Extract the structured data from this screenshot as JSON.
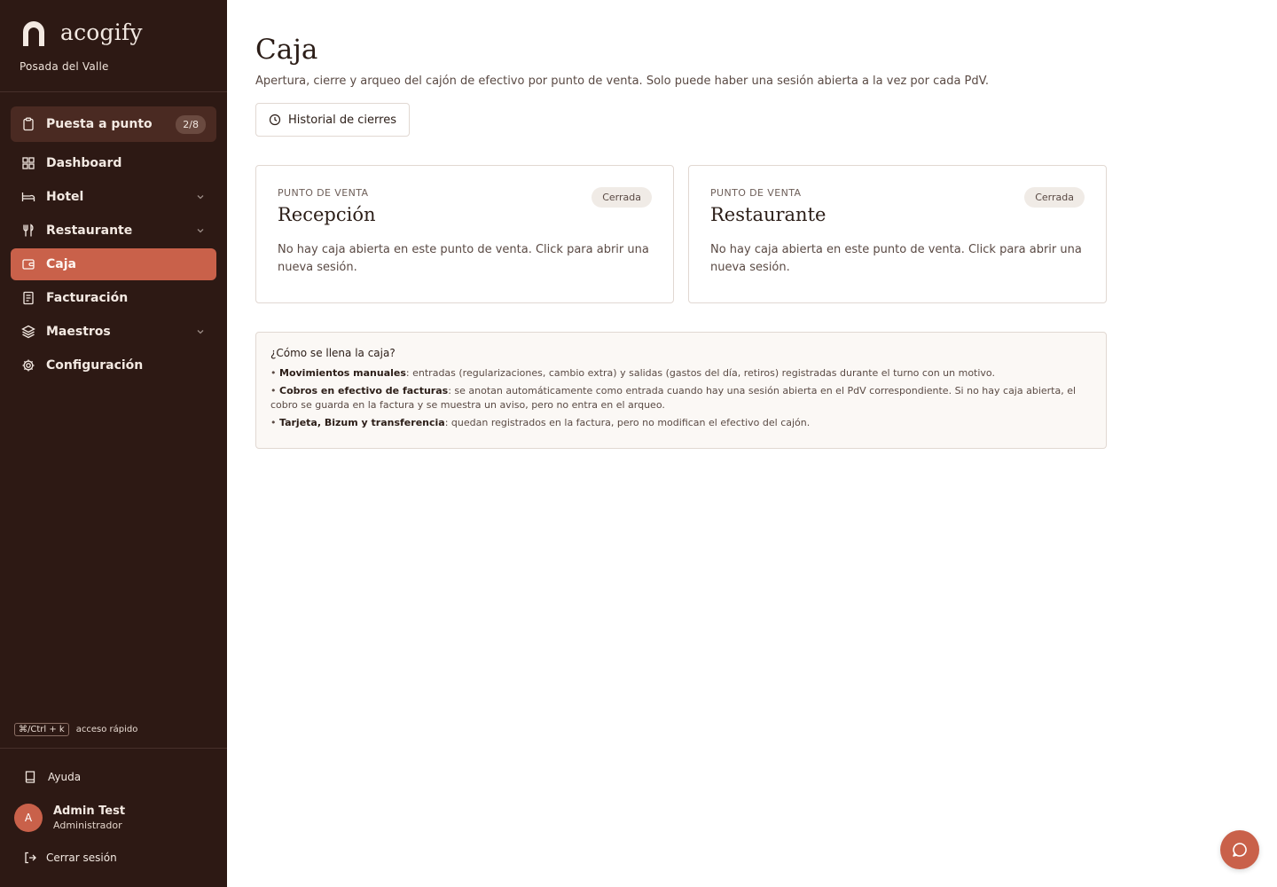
{
  "brand": {
    "name": "acogify",
    "property": "Posada del Valle"
  },
  "nav": {
    "setup": {
      "label": "Puesta a punto",
      "badge": "2/8",
      "icon": "clipboard-icon"
    },
    "items": [
      {
        "label": "Dashboard",
        "icon": "grid-icon",
        "expandable": false,
        "active": false
      },
      {
        "label": "Hotel",
        "icon": "bed-icon",
        "expandable": true,
        "active": false
      },
      {
        "label": "Restaurante",
        "icon": "utensils-icon",
        "expandable": true,
        "active": false
      },
      {
        "label": "Caja",
        "icon": "wallet-icon",
        "expandable": false,
        "active": true
      },
      {
        "label": "Facturación",
        "icon": "invoice-icon",
        "expandable": false,
        "active": false
      },
      {
        "label": "Maestros",
        "icon": "layers-icon",
        "expandable": true,
        "active": false
      },
      {
        "label": "Configuración",
        "icon": "gear-icon",
        "expandable": false,
        "active": false
      }
    ]
  },
  "shortcut": {
    "keys": "⌘/Ctrl + k",
    "label": "acceso rápido"
  },
  "footer": {
    "help": "Ayuda",
    "user": {
      "initial": "A",
      "name": "Admin Test",
      "role": "Administrador"
    },
    "logout": "Cerrar sesión"
  },
  "page": {
    "title": "Caja",
    "subtitle": "Apertura, cierre y arqueo del cajón de efectivo por punto de venta. Solo puede haber una sesión abierta a la vez por cada PdV.",
    "history_button": "Historial de cierres"
  },
  "points_of_sale": [
    {
      "eyebrow": "PUNTO DE VENTA",
      "name": "Recepción",
      "status": "Cerrada",
      "description": "No hay caja abierta en este punto de venta. Click para abrir una nueva sesión."
    },
    {
      "eyebrow": "PUNTO DE VENTA",
      "name": "Restaurante",
      "status": "Cerrada",
      "description": "No hay caja abierta en este punto de venta. Click para abrir una nueva sesión."
    }
  ],
  "info": {
    "title": "¿Cómo se llena la caja?",
    "lines": [
      {
        "bullet": "• ",
        "term": "Movimientos manuales",
        "text": ": entradas (regularizaciones, cambio extra) y salidas (gastos del día, retiros) registradas durante el turno con un motivo."
      },
      {
        "bullet": "• ",
        "term": "Cobros en efectivo de facturas",
        "text": ": se anotan automáticamente como entrada cuando hay una sesión abierta en el PdV correspondiente. Si no hay caja abierta, el cobro se guarda en la factura y se muestra un aviso, pero no entra en el arqueo."
      },
      {
        "bullet": "• ",
        "term": "Tarjeta, Bizum y transferencia",
        "text": ": quedan registrados en la factura, pero no modifican el efectivo del cajón."
      }
    ]
  },
  "colors": {
    "sidebar": "#2d1914",
    "accent": "#c9614a",
    "badge": "#f0ebe6"
  }
}
